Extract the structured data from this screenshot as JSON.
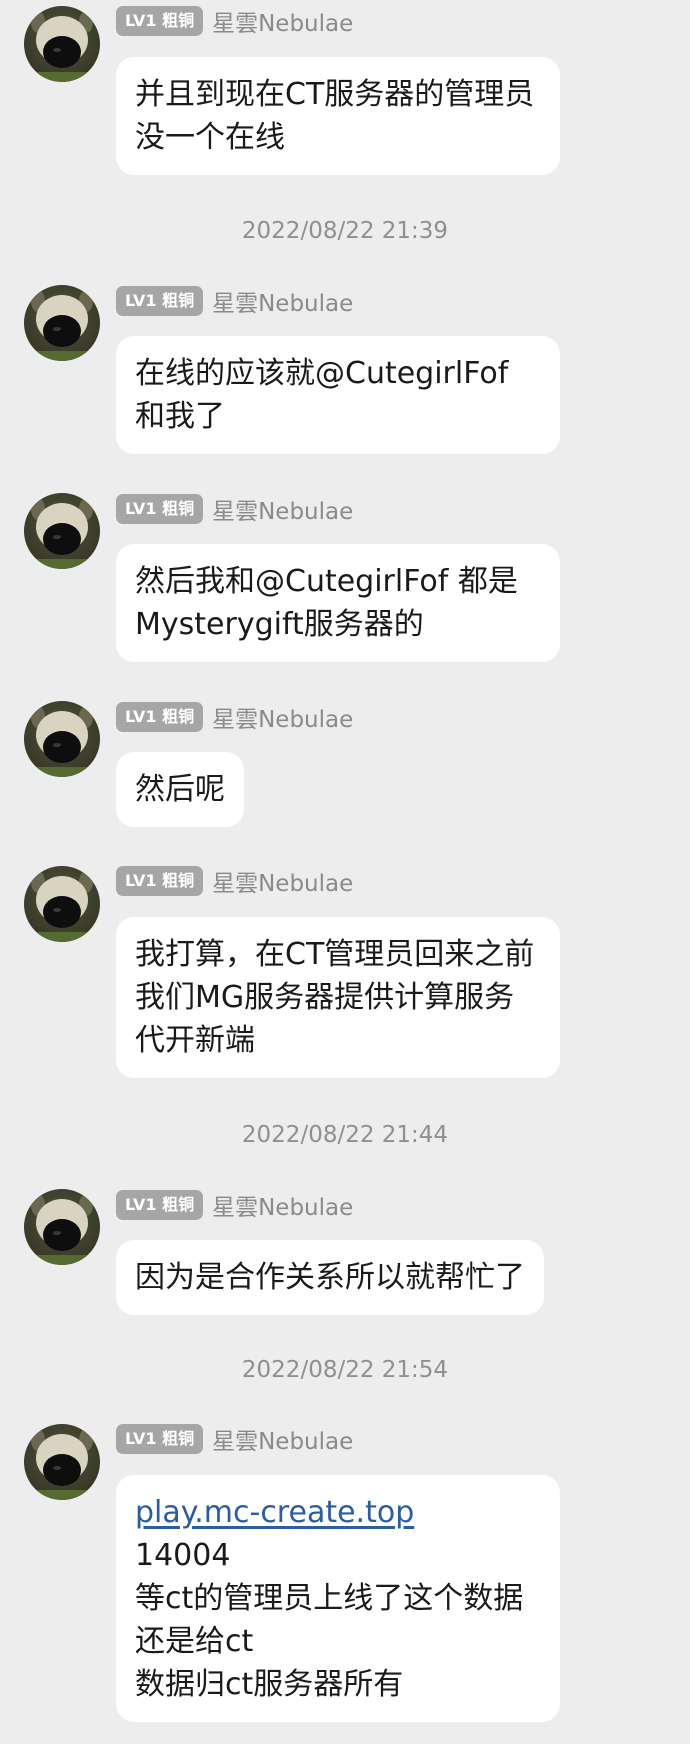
{
  "messages": [
    {
      "badge": "LV1 粗铜",
      "sender": "星雲Nebulae",
      "text": "并且到现在CT服务器的管理员没一个在线"
    },
    {
      "timestamp": "2022/08/22 21:39"
    },
    {
      "badge": "LV1 粗铜",
      "sender": "星雲Nebulae",
      "text": "在线的应该就@CutegirlFof 和我了"
    },
    {
      "badge": "LV1 粗铜",
      "sender": "星雲Nebulae",
      "text": "然后我和@CutegirlFof 都是Mysterygift服务器的"
    },
    {
      "badge": "LV1 粗铜",
      "sender": "星雲Nebulae",
      "text": "然后呢"
    },
    {
      "badge": "LV1 粗铜",
      "sender": "星雲Nebulae",
      "text": "我打算，在CT管理员回来之前我们MG服务器提供计算服务代开新端"
    },
    {
      "timestamp": "2022/08/22 21:44"
    },
    {
      "badge": "LV1 粗铜",
      "sender": "星雲Nebulae",
      "text": "因为是合作关系所以就帮忙了"
    },
    {
      "timestamp": "2022/08/22 21:54"
    },
    {
      "badge": "LV1 粗铜",
      "sender": "星雲Nebulae",
      "link": "play.mc-create.top",
      "lines": [
        "14004",
        "等ct的管理员上线了这个数据还是给ct",
        "数据归ct服务器所有"
      ]
    }
  ]
}
